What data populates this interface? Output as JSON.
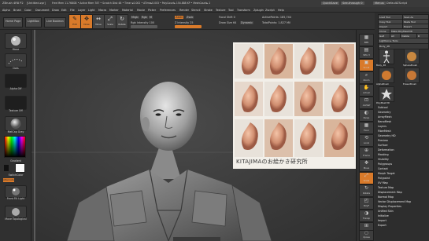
{
  "titlebar": {
    "app": "ZBrush 4R8 P2",
    "file": "[Untitled.zpr]",
    "stats": "Free Mem 11.768GB • Active Mem 787 • Scratch Disk 48 • Timer ▸0.002 • ATime▸0.003 • PolyCount▸ 154.888 KP • MeshCount▸ 2",
    "quicksave": "QuickSave",
    "seethrough": "See-through  0",
    "menus": "Menus",
    "script": "DefaultZScript"
  },
  "menubar": {
    "items": [
      "Alpha",
      "Brush",
      "Color",
      "Document",
      "Draw",
      "Edit",
      "File",
      "Layer",
      "Light",
      "Macro",
      "Marker",
      "Material",
      "Movie",
      "Picker",
      "Preferences",
      "Render",
      "Stencil",
      "Stroke",
      "Texture",
      "Tool",
      "Transform",
      "Zplugin",
      "Zscript",
      "Help"
    ]
  },
  "toolbar": {
    "lefttabs": [
      "Home Page",
      "LightBox",
      "Live Boolean"
    ],
    "buttons": [
      {
        "glyph": "✎",
        "label": "Edit",
        "active": true
      },
      {
        "glyph": "✥",
        "label": "Draw",
        "active": true
      },
      {
        "glyph": "↔",
        "label": "Move",
        "active": false
      },
      {
        "glyph": "⤢",
        "label": "Scale",
        "active": false
      },
      {
        "glyph": "↻",
        "label": "Rotate",
        "active": false
      }
    ],
    "mrgb": "Mrgb",
    "rgb": "Rgb",
    "m": "M",
    "rgb_intensity": "Rgb Intensity 100",
    "zadd": "Zadd",
    "zsub": "Zsub",
    "z_intensity": "Z Intensity 25",
    "focal_shift": "Focal Shift 0",
    "draw_size": "Draw Size 64",
    "dynamic": "Dynamic",
    "active_points": "ActivePoints: 185,744",
    "total_points": "TotalPoints: 1.827 Mil"
  },
  "left_shelf": {
    "brush": "Move",
    "stroke": "Dots",
    "alpha": "Alpha Off",
    "texture": "Texture Off",
    "material": "MatCap Gray",
    "gradient": "Gradient",
    "switch_color": "SwitchColor",
    "alternate": "Alternate",
    "bottom_label_1": "Front Fill Light",
    "bottom_label_2": "Move Topological"
  },
  "right_shelf": {
    "buttons": [
      {
        "glyph": "▦",
        "label": "BPR"
      },
      {
        "glyph": "▤",
        "label": "SPix 3"
      },
      {
        "glyph": "▣",
        "label": "Scroll"
      },
      {
        "glyph": "⌕",
        "label": "Zoom"
      },
      {
        "glyph": "✋",
        "label": "Actual"
      },
      {
        "glyph": "⊡",
        "label": "AAHalf"
      },
      {
        "glyph": "◐",
        "label": "Persp"
      },
      {
        "glyph": "▦",
        "label": "Floor"
      },
      {
        "glyph": "⟲",
        "label": "Local"
      },
      {
        "glyph": "⊕",
        "label": "Frame"
      },
      {
        "glyph": "✥",
        "label": "Move"
      },
      {
        "glyph": "⤢",
        "label": "Scale"
      },
      {
        "glyph": "↻",
        "label": "Rotate"
      },
      {
        "glyph": "◰",
        "label": "PolyF"
      },
      {
        "glyph": "◑",
        "label": "Transp"
      },
      {
        "glyph": "⊞",
        "label": "Solo"
      },
      {
        "glyph": "▢",
        "label": "Xpose"
      }
    ]
  },
  "tool_panel": {
    "top_buttons": [
      "Load Tool",
      "Save As",
      "Copy Tool",
      "Paste Tool",
      "Import",
      "Export",
      "Clone",
      "Make PolyMesh3D",
      "GoZ",
      "All",
      "Visible",
      "R",
      "Lightbox ▸ Tools"
    ],
    "current_tool": "Body_48",
    "subtools": [
      "Body_48",
      "SphereBrush",
      "AlphaBrush",
      "SimpleBrush",
      "EraserBrush",
      "PolyMesh3D"
    ],
    "sections": [
      "Subtool",
      "Geometry",
      "ArrayMesh",
      "NanoMesh",
      "Layers",
      "FiberMesh",
      "Geometry HD",
      "Preview",
      "Surface",
      "Deformation",
      "Masking",
      "Visibility",
      "Polygroups",
      "Contact",
      "Morph Target",
      "Polypaint",
      "UV Map",
      "Texture Map",
      "Displacement Map",
      "Normal Map",
      "Vector Displacement Map",
      "Display Properties",
      "Unified Skin",
      "Initialize",
      "Import",
      "Export"
    ]
  },
  "reference": {
    "caption": "KITAJIMAのお絵かき研究所"
  },
  "colors": {
    "accent": "#d97a2a",
    "panel": "#303030",
    "viewport": "#3f3f3f"
  }
}
